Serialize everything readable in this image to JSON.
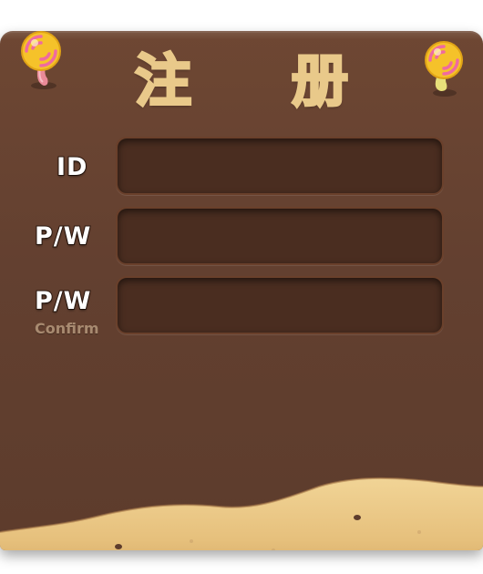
{
  "window": {
    "title_chars": [
      "注",
      "册"
    ]
  },
  "form": {
    "id_label": "ID",
    "password_label": "P/W",
    "confirm_password_label": "P/W",
    "confirm_sublabel": "Confirm",
    "id_value": "",
    "password_value": "",
    "confirm_value": ""
  },
  "decor": {
    "pins": [
      "lollipop-pink-icon",
      "lollipop-yellow-icon"
    ],
    "board_color": "#634030",
    "field_color": "#4a2d20",
    "title_outline_color": "#e9c98a",
    "cookie_color": "#e9c98a"
  }
}
